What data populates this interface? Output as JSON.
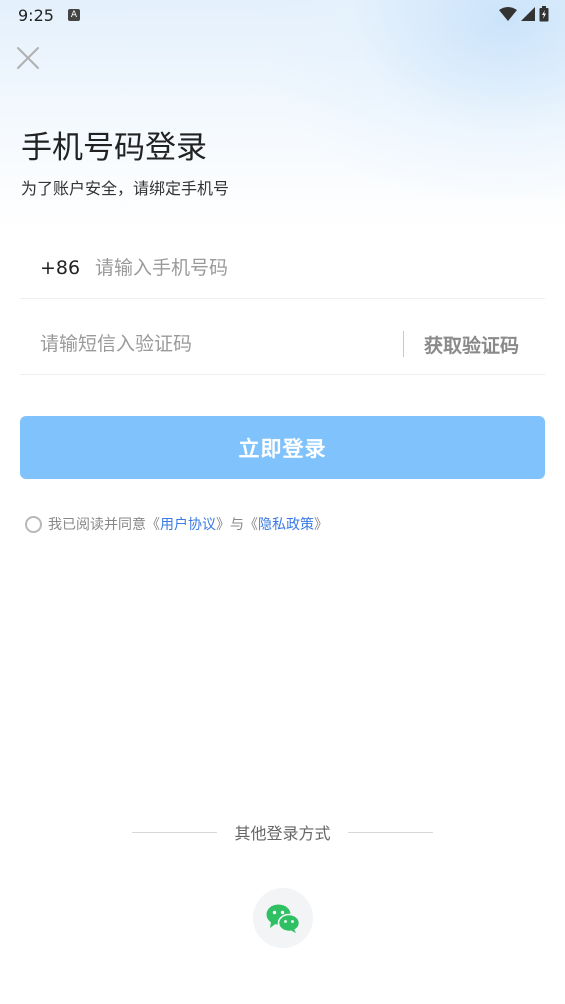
{
  "status_bar": {
    "time": "9:25",
    "notification_badge": "A"
  },
  "header": {
    "title": "手机号码登录",
    "subtitle": "为了账户安全，请绑定手机号"
  },
  "phone_field": {
    "prefix": "+86",
    "value": "",
    "placeholder": "请输入手机号码"
  },
  "code_field": {
    "value": "",
    "placeholder": "请输短信入验证码",
    "get_code_label": "获取验证码"
  },
  "login_button": {
    "label": "立即登录",
    "color": "#80c2fb"
  },
  "agreement": {
    "prefix": "我已阅读并同意《",
    "user_agreement": "用户协议",
    "middle": "》与《",
    "privacy_policy": "隐私政策",
    "suffix": "》",
    "link_color": "#3a7be6"
  },
  "other_login": {
    "label": "其他登录方式",
    "wechat_icon": "wechat-icon",
    "wechat_color": "#2fc064"
  }
}
